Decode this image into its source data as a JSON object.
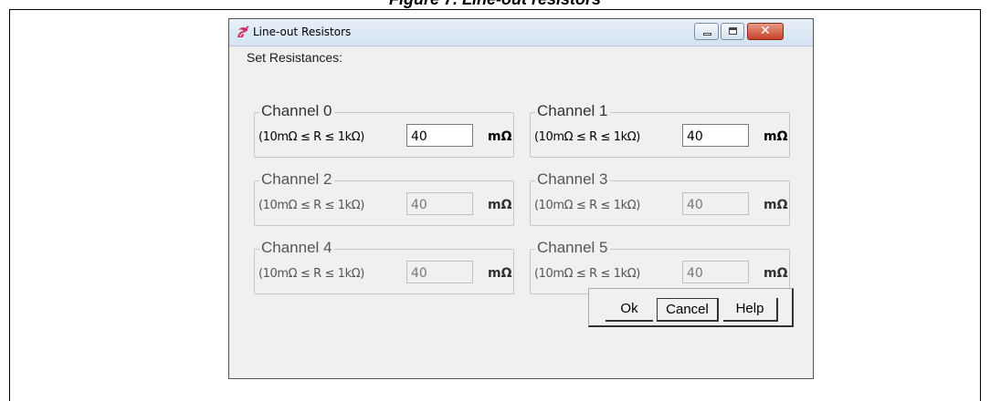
{
  "page": {
    "caption": "Figure 7. Line-out resistors"
  },
  "window": {
    "title": "Line-out Resistors",
    "icon": "flame-icon",
    "controls": {
      "minimize": "minimize-icon",
      "maximize": "maximize-icon",
      "close": "✕"
    }
  },
  "form": {
    "set_label": "Set Resistances:",
    "channels": [
      {
        "name": "Channel 0",
        "range": "(10mΩ ≤ R ≤ 1kΩ)",
        "value": "40",
        "unit": "mΩ",
        "enabled": true
      },
      {
        "name": "Channel 1",
        "range": "(10mΩ ≤ R ≤ 1kΩ)",
        "value": "40",
        "unit": "mΩ",
        "enabled": true
      },
      {
        "name": "Channel 2",
        "range": "(10mΩ ≤ R ≤ 1kΩ)",
        "value": "40",
        "unit": "mΩ",
        "enabled": false
      },
      {
        "name": "Channel 3",
        "range": "(10mΩ ≤ R ≤ 1kΩ)",
        "value": "40",
        "unit": "mΩ",
        "enabled": false
      },
      {
        "name": "Channel 4",
        "range": "(10mΩ ≤ R ≤ 1kΩ)",
        "value": "40",
        "unit": "mΩ",
        "enabled": false
      },
      {
        "name": "Channel 5",
        "range": "(10mΩ ≤ R ≤ 1kΩ)",
        "value": "40",
        "unit": "mΩ",
        "enabled": false
      }
    ]
  },
  "buttons": {
    "ok": "Ok",
    "cancel": "Cancel",
    "help": "Help"
  }
}
